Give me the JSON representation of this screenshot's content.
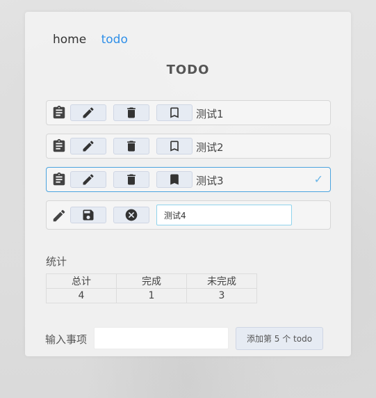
{
  "nav": {
    "home": "home",
    "todo": "todo"
  },
  "page_title": "TODO",
  "todos": [
    {
      "label": "测试1",
      "done": false
    },
    {
      "label": "测试2",
      "done": false
    },
    {
      "label": "测试3",
      "done": true,
      "check_mark": "✓"
    }
  ],
  "editing": {
    "value": "测试4"
  },
  "stats": {
    "title": "统计",
    "headers": [
      "总计",
      "完成",
      "未完成"
    ],
    "values": [
      "4",
      "1",
      "3"
    ]
  },
  "add": {
    "label": "输入事项",
    "input_value": "",
    "button_label": "添加第 5 个 todo"
  },
  "colors": {
    "accent": "#2f8fe8",
    "check": "#6bb6e8",
    "button_bg": "#e6ebf3"
  },
  "icons": [
    "clipboard-icon",
    "pencil-icon",
    "trash-icon",
    "bookmark-icon",
    "save-icon",
    "cancel-icon",
    "check-icon"
  ]
}
